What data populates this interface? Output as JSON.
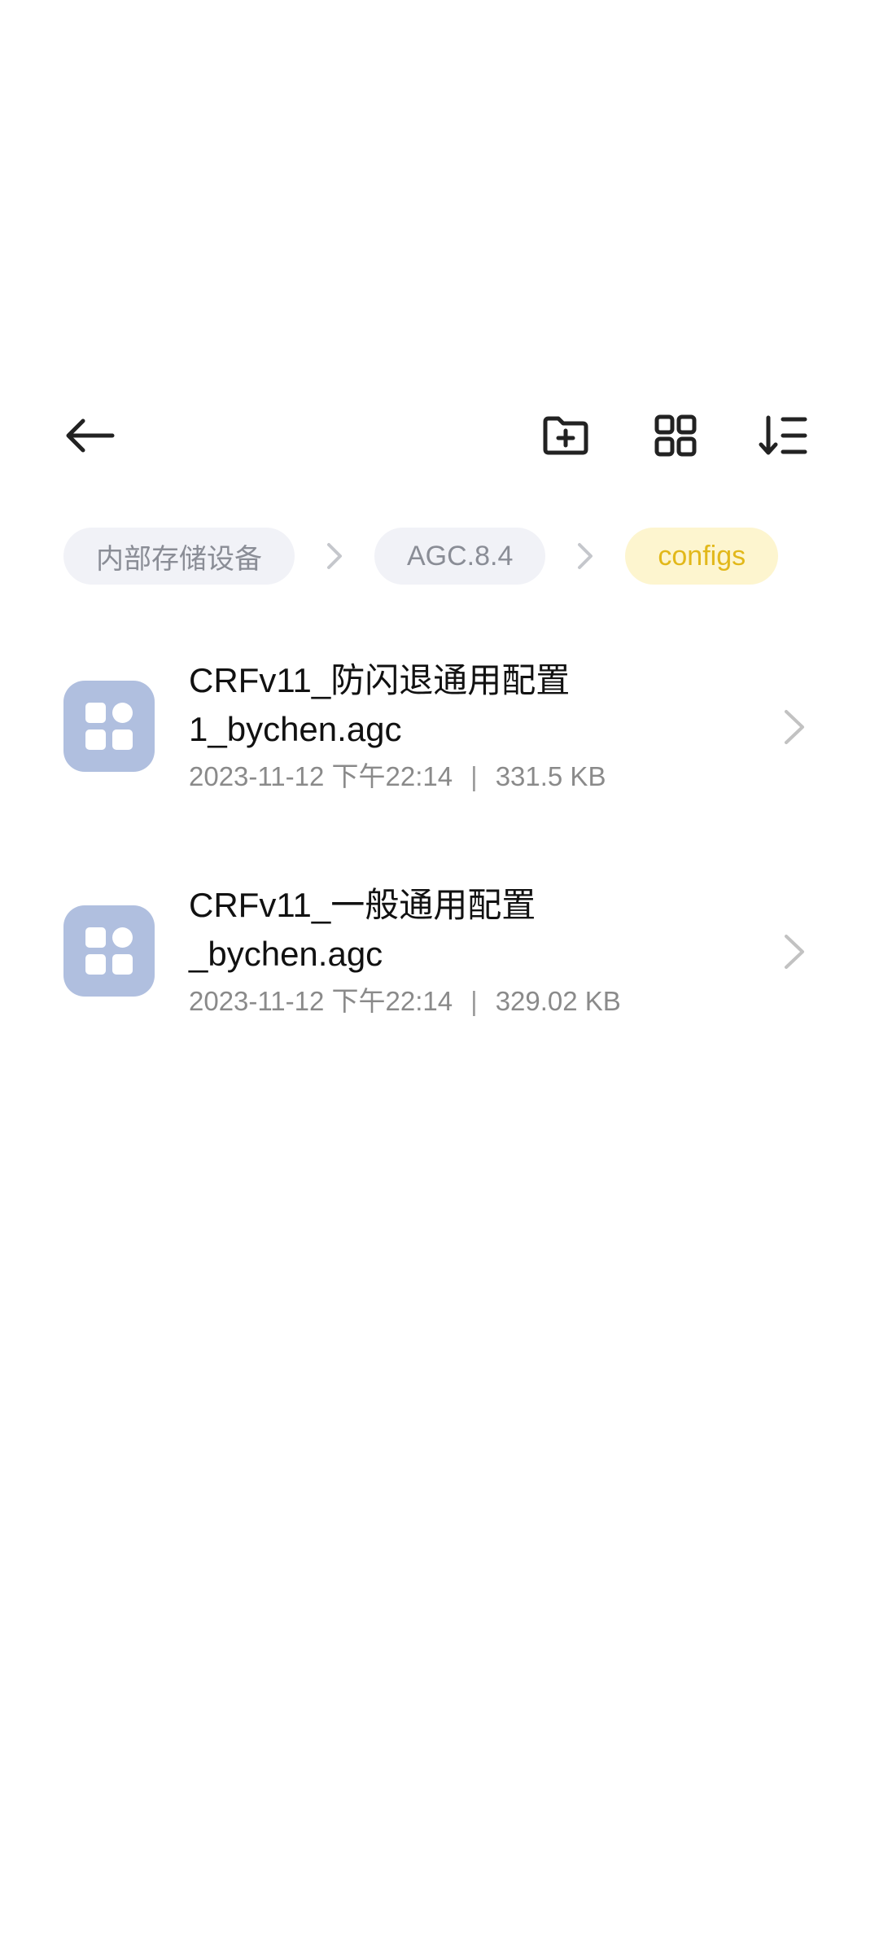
{
  "toolbar": {
    "back_icon": "arrow-left-icon",
    "new_folder_icon": "folder-plus-icon",
    "view_icon": "grid-view-icon",
    "sort_icon": "sort-down-icon"
  },
  "breadcrumb": {
    "items": [
      {
        "label": "内部存储设备",
        "active": false
      },
      {
        "label": "AGC.8.4",
        "active": false
      },
      {
        "label": "configs",
        "active": true
      }
    ]
  },
  "files": [
    {
      "name": "CRFv11_防闪退通用配置1_bychen.agc",
      "date": "2023-11-12 下午22:14",
      "separator": "|",
      "size": "331.5 KB"
    },
    {
      "name": "CRFv11_一般通用配置_bychen.agc",
      "date": "2023-11-12 下午22:14",
      "separator": "|",
      "size": "329.02 KB"
    }
  ],
  "colors": {
    "accent_yellow": "#e2b81a",
    "crumb_active_bg": "#fdf5cf",
    "crumb_bg": "#f1f2f7",
    "file_icon_bg": "#b0bfdf"
  }
}
